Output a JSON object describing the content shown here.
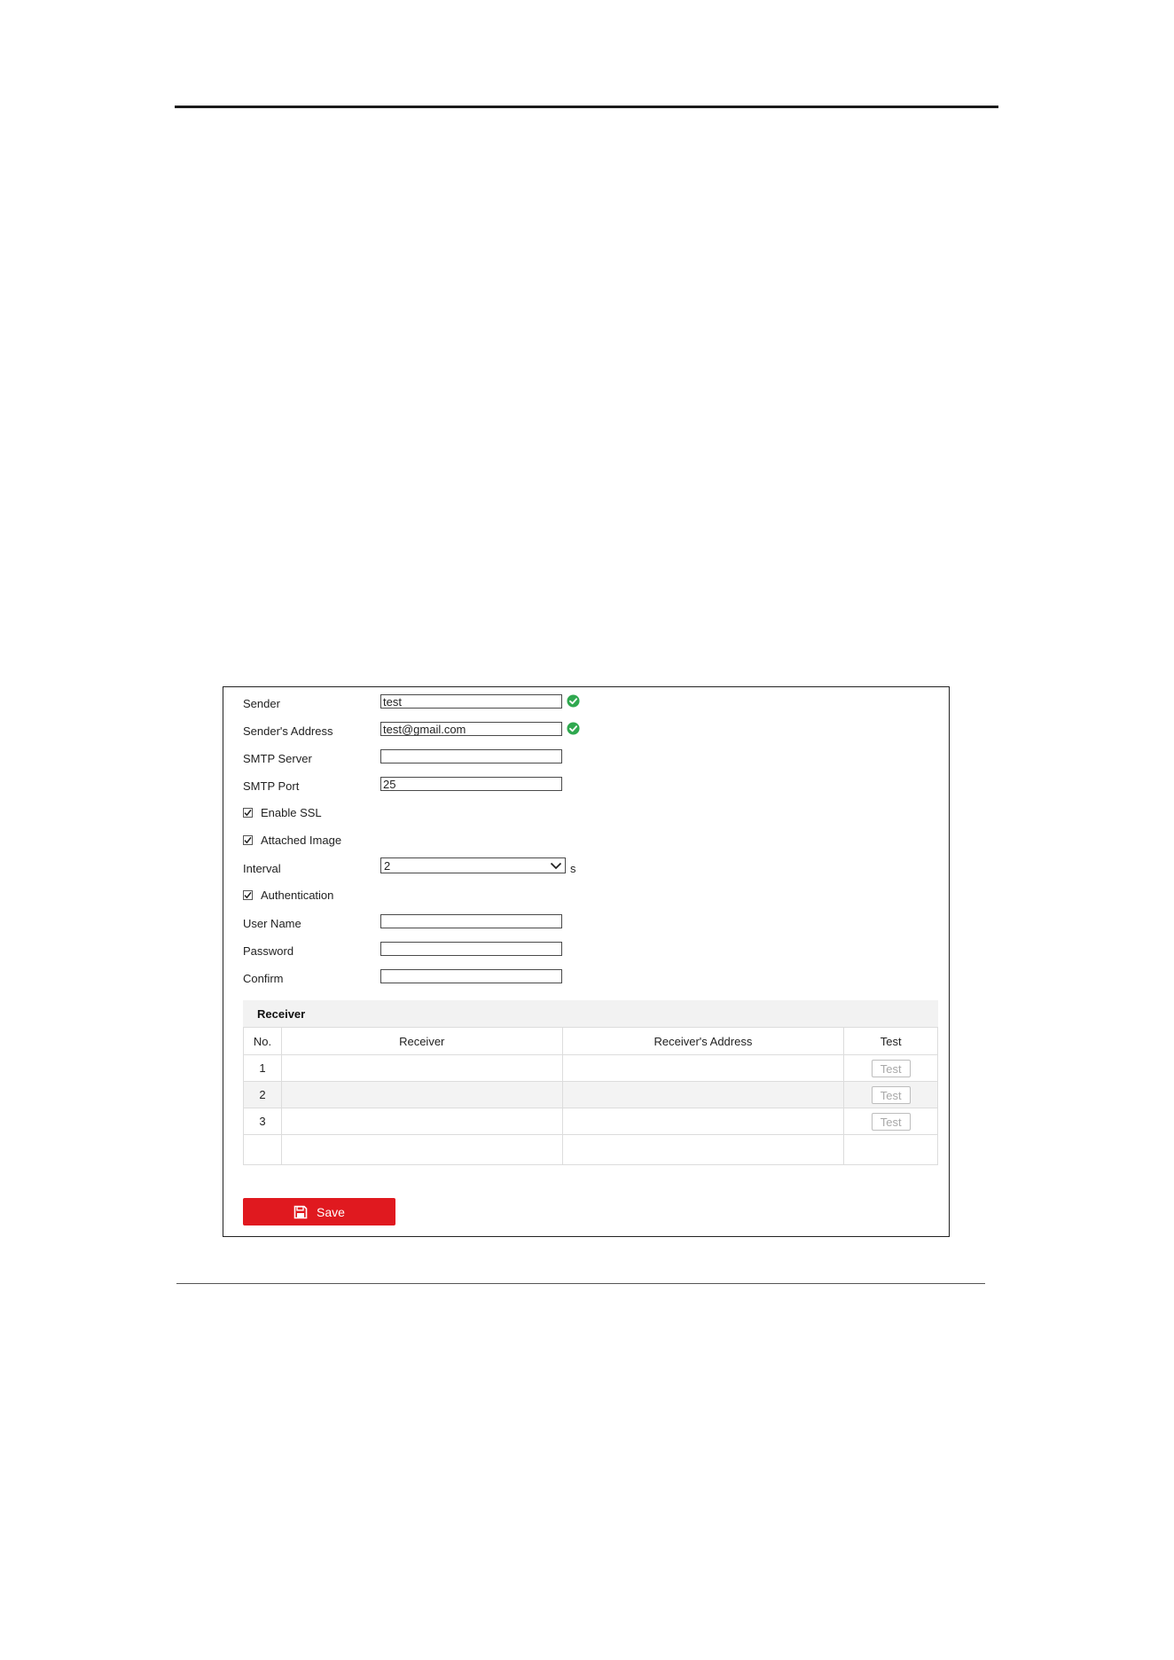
{
  "form": {
    "sender_label": "Sender",
    "sender_value": "test",
    "sender_address_label": "Sender's Address",
    "sender_address_value": "test@gmail.com",
    "smtp_server_label": "SMTP Server",
    "smtp_server_value": "",
    "smtp_port_label": "SMTP Port",
    "smtp_port_value": "25",
    "enable_ssl_label": "Enable SSL",
    "enable_ssl_checked": true,
    "attached_image_label": "Attached Image",
    "attached_image_checked": true,
    "interval_label": "Interval",
    "interval_value": "2",
    "interval_unit": "s",
    "authentication_label": "Authentication",
    "authentication_checked": true,
    "user_name_label": "User Name",
    "user_name_value": "",
    "password_label": "Password",
    "password_value": "",
    "confirm_label": "Confirm",
    "confirm_value": ""
  },
  "receiver": {
    "header": "Receiver",
    "columns": [
      "No.",
      "Receiver",
      "Receiver's Address",
      "Test"
    ],
    "rows": [
      {
        "no": "1",
        "receiver": "",
        "address": "",
        "test_label": "Test"
      },
      {
        "no": "2",
        "receiver": "",
        "address": "",
        "test_label": "Test"
      },
      {
        "no": "3",
        "receiver": "",
        "address": "",
        "test_label": "Test"
      }
    ]
  },
  "save_button": {
    "label": "Save",
    "icon": "save-icon"
  },
  "colors": {
    "accent": "#e0191f",
    "valid": "#2fa84f",
    "row_alt": "#f3f3f3"
  }
}
